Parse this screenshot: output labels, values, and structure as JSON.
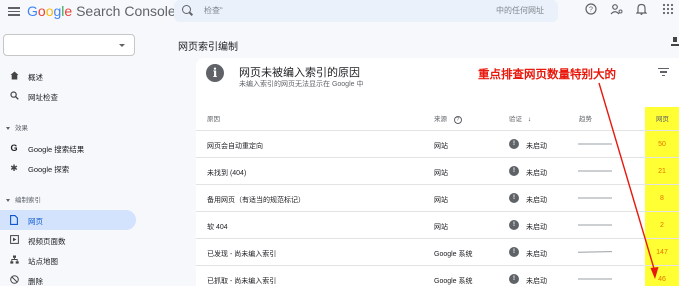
{
  "app": {
    "title_part1": "G",
    "title_part2": "o",
    "title_part3": "o",
    "title_part4": "g",
    "title_part5": "l",
    "title_part6": "e",
    "title_product": " Search Console"
  },
  "search": {
    "placeholder_left": "检查“",
    "placeholder_right": "中的任何网址"
  },
  "topbar_icons": [
    "help-icon",
    "users-settings-icon",
    "bell-icon",
    "apps-icon"
  ],
  "sidebar": {
    "property_value": "",
    "items": [
      {
        "label": "概述",
        "icon": "home-icon"
      },
      {
        "label": "网址检查",
        "icon": "search-icon"
      }
    ],
    "section_performance": "效果",
    "performance_items": [
      {
        "label": "Google 搜索结果",
        "icon": "google-g-icon"
      },
      {
        "label": "Google 探索",
        "icon": "asterisk-icon"
      }
    ],
    "section_indexing": "编制索引",
    "indexing_items": [
      {
        "label": "网页",
        "icon": "pages-icon",
        "active": true
      },
      {
        "label": "视频页面数",
        "icon": "video-icon"
      },
      {
        "label": "站点地图",
        "icon": "sitemap-icon"
      },
      {
        "label": "删除",
        "icon": "remove-icon"
      }
    ]
  },
  "page": {
    "title": "网页索引编制"
  },
  "card": {
    "title": "网页未被编入索引的原因",
    "subtitle": "未编入索引的网页无法显示在 Google 中",
    "annotation": "重点排查网页数量特别大的",
    "headers": {
      "reason": "原因",
      "source": "来源",
      "validation": "验证",
      "trend": "趋势",
      "pages": "网页"
    },
    "rows": [
      {
        "reason": "网页会自动重定向",
        "source": "网站",
        "status": "未启动",
        "pages": "50"
      },
      {
        "reason": "未找到 (404)",
        "source": "网站",
        "status": "未启动",
        "pages": "21"
      },
      {
        "reason": "备用网页（有适当的规范标记）",
        "source": "网站",
        "status": "未启动",
        "pages": "8"
      },
      {
        "reason": "软 404",
        "source": "网站",
        "status": "未启动",
        "pages": "2"
      },
      {
        "reason": "已发现 - 尚未编入索引",
        "source": "Google 系统",
        "status": "未启动",
        "pages": "147"
      },
      {
        "reason": "已抓取 - 尚未编入索引",
        "source": "Google 系统",
        "status": "未启动",
        "pages": "46"
      }
    ]
  },
  "colors": {
    "annotation": "#e8180c",
    "highlight": "#ffff33",
    "active_nav": "#d3e3fd"
  }
}
